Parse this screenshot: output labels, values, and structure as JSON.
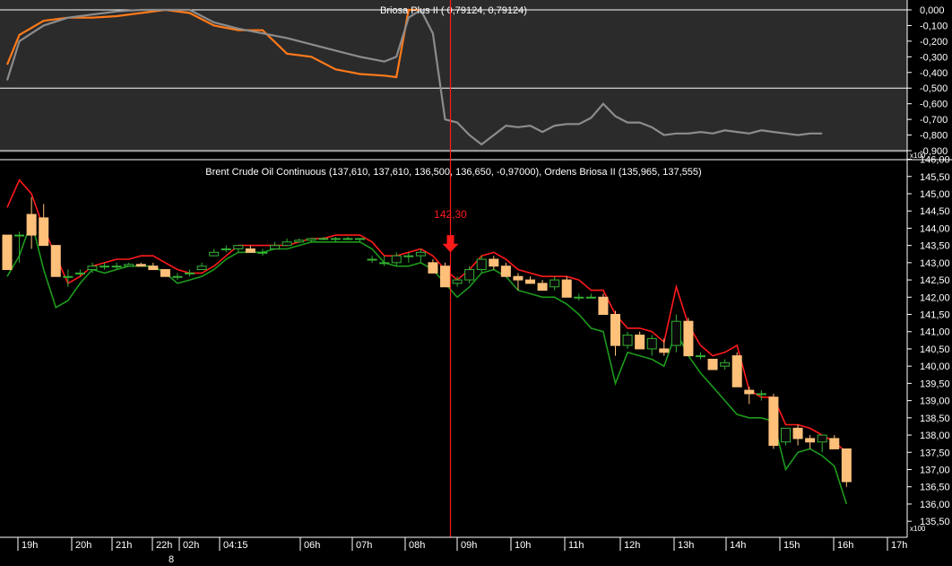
{
  "colors": {
    "background": "#000000",
    "panel_top": "#2b2b2b",
    "grid": "#ffffff",
    "price_bull": "#0a0a0a",
    "price_bear": "#ffc07a",
    "candle_outline_bull": "#34b034",
    "upper_band": "#ff1a1a",
    "lower_band": "#1c9a1c",
    "osc_orange": "#ff7a1a",
    "osc_gray": "#8c8c8c",
    "marker": "#ff1a1a"
  },
  "chart_data": [
    {
      "type": "line",
      "title": "Briosa Plus II ( 0,79124,  0,79124)",
      "ylim": [
        -0.9,
        0.0
      ],
      "y_ticks": [
        "0,000",
        "-0,100",
        "-0,200",
        "-0,300",
        "-0,400",
        "-0,500",
        "-0,600",
        "-0,700",
        "-0,800",
        "-0,900"
      ],
      "y_scale_label": "x100",
      "series": [
        {
          "color": "orange",
          "points": [
            [
              0,
              -0.35
            ],
            [
              1,
              -0.16
            ],
            [
              3,
              -0.07
            ],
            [
              5,
              -0.05
            ],
            [
              7,
              -0.05
            ],
            [
              9,
              -0.04
            ],
            [
              11,
              -0.02
            ],
            [
              13,
              -0.0
            ],
            [
              15,
              -0.02
            ],
            [
              17,
              -0.1
            ],
            [
              19,
              -0.13
            ],
            [
              21,
              -0.13
            ],
            [
              23,
              -0.28
            ],
            [
              25,
              -0.3
            ],
            [
              27,
              -0.38
            ],
            [
              29,
              -0.41
            ],
            [
              31,
              -0.42
            ],
            [
              32,
              -0.43
            ],
            [
              33,
              -0.0
            ],
            [
              34,
              -0.0
            ]
          ]
        },
        {
          "color": "gray",
          "points": [
            [
              0,
              -0.45
            ],
            [
              1,
              -0.2
            ],
            [
              3,
              -0.1
            ],
            [
              5,
              -0.05
            ],
            [
              7,
              -0.03
            ],
            [
              9,
              -0.01
            ],
            [
              11,
              -0.0
            ],
            [
              13,
              -0.0
            ],
            [
              15,
              -0.0
            ],
            [
              17,
              -0.08
            ],
            [
              19,
              -0.12
            ],
            [
              21,
              -0.15
            ],
            [
              23,
              -0.18
            ],
            [
              25,
              -0.22
            ],
            [
              27,
              -0.26
            ],
            [
              29,
              -0.3
            ],
            [
              31,
              -0.33
            ],
            [
              32,
              -0.3
            ],
            [
              33,
              -0.05
            ],
            [
              34,
              -0.0
            ],
            [
              35,
              -0.15
            ],
            [
              36,
              -0.7
            ],
            [
              37,
              -0.72
            ],
            [
              38,
              -0.8
            ],
            [
              39,
              -0.86
            ],
            [
              40,
              -0.8
            ],
            [
              41,
              -0.74
            ],
            [
              42,
              -0.75
            ],
            [
              43,
              -0.74
            ],
            [
              44,
              -0.78
            ],
            [
              45,
              -0.74
            ],
            [
              46,
              -0.73
            ],
            [
              47,
              -0.73
            ],
            [
              48,
              -0.69
            ],
            [
              49,
              -0.6
            ],
            [
              50,
              -0.68
            ],
            [
              51,
              -0.72
            ],
            [
              52,
              -0.72
            ],
            [
              53,
              -0.75
            ],
            [
              54,
              -0.8
            ],
            [
              55,
              -0.79
            ],
            [
              56,
              -0.79
            ],
            [
              57,
              -0.78
            ],
            [
              58,
              -0.79
            ],
            [
              59,
              -0.77
            ],
            [
              60,
              -0.78
            ],
            [
              61,
              -0.79
            ],
            [
              62,
              -0.77
            ],
            [
              63,
              -0.78
            ],
            [
              64,
              -0.79
            ],
            [
              65,
              -0.8
            ],
            [
              66,
              -0.79
            ],
            [
              67,
              -0.79
            ]
          ]
        }
      ]
    },
    {
      "type": "candlestick",
      "title": "Brent Crude Oil Continuous (137,610, 137,610, 136,500, 136,650, -0,97000), Ordens Briosa II (135,965, 137,555)",
      "ylim": [
        135.4,
        146.3
      ],
      "y_ticks": [
        "146,00",
        "145,50",
        "145,00",
        "144,50",
        "144,00",
        "143,50",
        "143,00",
        "142,50",
        "142,00",
        "141,50",
        "141,00",
        "140,50",
        "140,00",
        "139,50",
        "139,00",
        "138,50",
        "138,00",
        "137,50",
        "137,00",
        "136,50",
        "136,00",
        "135,50"
      ],
      "y_scale_label": "x100",
      "x_ticks": [
        "19h",
        "20h",
        "21h",
        "22h",
        "02h",
        "04:15",
        "06h",
        "07h",
        "08h",
        "09h",
        "10h",
        "11h",
        "12h",
        "13h",
        "14h",
        "15h",
        "16h",
        "17h"
      ],
      "x_sub_label": "8",
      "annotation": {
        "label": "142,30",
        "index": 36
      },
      "candles": [
        [
          143.8,
          143.8,
          142.8,
          142.8
        ],
        [
          143.8,
          143.9,
          143.0,
          143.8
        ],
        [
          144.4,
          144.9,
          143.4,
          143.8
        ],
        [
          144.3,
          144.7,
          143.5,
          143.5
        ],
        [
          143.5,
          143.5,
          142.8,
          142.6
        ],
        [
          142.6,
          142.8,
          142.3,
          142.6
        ],
        [
          142.7,
          142.8,
          142.6,
          142.7
        ],
        [
          142.8,
          143.0,
          142.7,
          142.9
        ],
        [
          142.9,
          143.0,
          142.8,
          142.9
        ],
        [
          142.9,
          143.0,
          142.8,
          142.9
        ],
        [
          142.9,
          143.0,
          142.9,
          142.95
        ],
        [
          142.95,
          143.0,
          142.9,
          142.9
        ],
        [
          142.9,
          143.0,
          142.8,
          142.8
        ],
        [
          142.8,
          142.8,
          142.6,
          142.6
        ],
        [
          142.6,
          142.7,
          142.5,
          142.6
        ],
        [
          142.7,
          142.8,
          142.6,
          142.7
        ],
        [
          142.8,
          143.0,
          142.8,
          142.9
        ],
        [
          143.2,
          143.4,
          143.2,
          143.3
        ],
        [
          143.4,
          143.5,
          143.3,
          143.4
        ],
        [
          143.4,
          143.5,
          143.3,
          143.5
        ],
        [
          143.4,
          143.5,
          143.3,
          143.3
        ],
        [
          143.3,
          143.4,
          143.2,
          143.3
        ],
        [
          143.4,
          143.6,
          143.4,
          143.5
        ],
        [
          143.5,
          143.7,
          143.5,
          143.6
        ],
        [
          143.6,
          143.7,
          143.6,
          143.65
        ],
        [
          143.65,
          143.7,
          143.6,
          143.7
        ],
        [
          143.7,
          143.75,
          143.65,
          143.7
        ],
        [
          143.7,
          143.75,
          143.6,
          143.7
        ],
        [
          143.7,
          143.75,
          143.65,
          143.7
        ],
        [
          143.7,
          143.7,
          143.6,
          143.7
        ],
        [
          143.1,
          143.2,
          143.0,
          143.1
        ],
        [
          143.0,
          143.2,
          142.9,
          143.0
        ],
        [
          143.0,
          143.3,
          142.9,
          143.2
        ],
        [
          143.2,
          143.3,
          143.0,
          143.2
        ],
        [
          143.2,
          143.4,
          143.0,
          143.3
        ],
        [
          143.0,
          143.1,
          142.7,
          142.7
        ],
        [
          142.9,
          143.0,
          142.3,
          142.3
        ],
        [
          142.4,
          142.6,
          142.3,
          142.5
        ],
        [
          142.5,
          142.9,
          142.4,
          142.8
        ],
        [
          142.8,
          143.2,
          142.7,
          143.1
        ],
        [
          143.1,
          143.2,
          142.8,
          142.9
        ],
        [
          142.9,
          143.0,
          142.6,
          142.6
        ],
        [
          142.6,
          142.7,
          142.2,
          142.5
        ],
        [
          142.5,
          142.6,
          142.4,
          142.4
        ],
        [
          142.4,
          142.5,
          142.2,
          142.2
        ],
        [
          142.3,
          142.6,
          142.2,
          142.5
        ],
        [
          142.5,
          142.6,
          142.0,
          142.0
        ],
        [
          142.0,
          142.1,
          141.9,
          142.0
        ],
        [
          142.0,
          142.1,
          142.0,
          142.0
        ],
        [
          142.0,
          142.1,
          141.5,
          141.5
        ],
        [
          141.5,
          141.6,
          140.3,
          140.6
        ],
        [
          140.6,
          141.0,
          140.5,
          140.9
        ],
        [
          140.9,
          141.0,
          140.5,
          140.5
        ],
        [
          140.5,
          140.9,
          140.3,
          140.8
        ],
        [
          140.5,
          140.8,
          140.3,
          140.4
        ],
        [
          140.6,
          141.5,
          140.4,
          141.3
        ],
        [
          141.3,
          141.4,
          140.3,
          140.3
        ],
        [
          140.3,
          140.4,
          140.2,
          140.3
        ],
        [
          140.2,
          140.2,
          139.9,
          139.9
        ],
        [
          140.0,
          140.2,
          139.9,
          140.1
        ],
        [
          140.3,
          140.4,
          139.4,
          139.4
        ],
        [
          139.3,
          139.4,
          138.9,
          139.2
        ],
        [
          139.2,
          139.3,
          139.0,
          139.2
        ],
        [
          139.1,
          139.2,
          137.6,
          137.7
        ],
        [
          137.8,
          138.2,
          137.7,
          138.2
        ],
        [
          138.2,
          138.3,
          137.7,
          137.9
        ],
        [
          137.9,
          138.0,
          137.6,
          137.8
        ],
        [
          137.8,
          138.0,
          137.5,
          138.0
        ],
        [
          137.9,
          138.0,
          137.6,
          137.6
        ],
        [
          137.6,
          137.6,
          136.5,
          136.65
        ]
      ],
      "series": [
        {
          "color": "red",
          "values": [
            144.6,
            145.4,
            145.0,
            144.0,
            143.2,
            142.4,
            142.6,
            142.9,
            143.0,
            143.1,
            143.1,
            143.2,
            143.2,
            143.0,
            142.8,
            142.7,
            142.7,
            142.9,
            143.2,
            143.5,
            143.5,
            143.5,
            143.5,
            143.5,
            143.6,
            143.7,
            143.7,
            143.8,
            143.8,
            143.8,
            143.6,
            143.2,
            143.2,
            143.3,
            143.4,
            143.2,
            142.8,
            142.5,
            142.8,
            143.2,
            143.3,
            143.1,
            142.8,
            142.7,
            142.6,
            142.6,
            142.6,
            142.5,
            142.2,
            142.2,
            141.5,
            141.1,
            141.1,
            141.0,
            140.7,
            142.3,
            141.2,
            140.6,
            140.3,
            140.4,
            140.6,
            139.3,
            139.1,
            139.1,
            138.3,
            138.3,
            138.2,
            138.0,
            137.8,
            137.5
          ]
        },
        {
          "color": "green",
          "values": [
            142.6,
            143.2,
            144.2,
            142.8,
            141.7,
            141.9,
            142.4,
            142.8,
            142.7,
            142.8,
            142.9,
            142.9,
            142.9,
            142.7,
            142.4,
            142.5,
            142.6,
            142.8,
            143.1,
            143.3,
            143.3,
            143.3,
            143.4,
            143.4,
            143.5,
            143.6,
            143.6,
            143.6,
            143.6,
            143.6,
            143.4,
            143.0,
            142.9,
            142.9,
            143.0,
            142.8,
            142.4,
            142.0,
            142.3,
            142.7,
            142.8,
            142.6,
            142.2,
            142.1,
            142.0,
            142.0,
            141.8,
            141.5,
            141.1,
            141.0,
            139.5,
            140.4,
            140.3,
            140.2,
            140.0,
            141.0,
            140.3,
            139.8,
            139.4,
            139.0,
            138.6,
            138.5,
            138.5,
            138.4,
            137.0,
            137.5,
            137.6,
            137.4,
            137.1,
            136.0
          ]
        }
      ]
    }
  ]
}
